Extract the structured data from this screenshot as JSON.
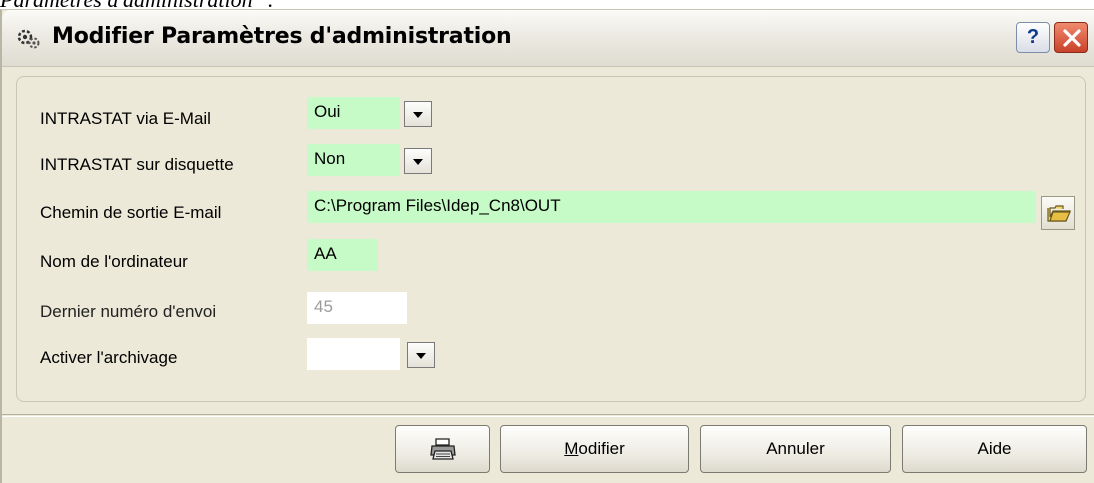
{
  "caption": "Paramètres d'administration\" :",
  "window": {
    "title": "Modifier Paramètres d'administration",
    "help_label": "?"
  },
  "form": {
    "intrastat_email": {
      "label": "INTRASTAT via E-Mail",
      "value": "Oui"
    },
    "intrastat_disk": {
      "label": "INTRASTAT sur disquette",
      "value": "Non"
    },
    "email_path": {
      "label": "Chemin de sortie E-mail",
      "value": "C:\\Program Files\\Idep_Cn8\\OUT"
    },
    "computer_name": {
      "label": "Nom de l'ordinateur",
      "value": "AA"
    },
    "last_send_number": {
      "label": "Dernier numéro d'envoi",
      "value": "45"
    },
    "archiving": {
      "label": "Activer l'archivage",
      "value": ""
    }
  },
  "buttons": {
    "modify_first": "M",
    "modify_rest": "odifier",
    "cancel": "Annuler",
    "help": "Aide"
  },
  "colors": {
    "field_highlight": "#c6fac6",
    "dialog_bg": "#ece9d8"
  },
  "icons": [
    "settings-gears-icon",
    "help-icon",
    "close-icon",
    "dropdown-arrow-icon",
    "open-folder-icon",
    "printer-icon"
  ]
}
